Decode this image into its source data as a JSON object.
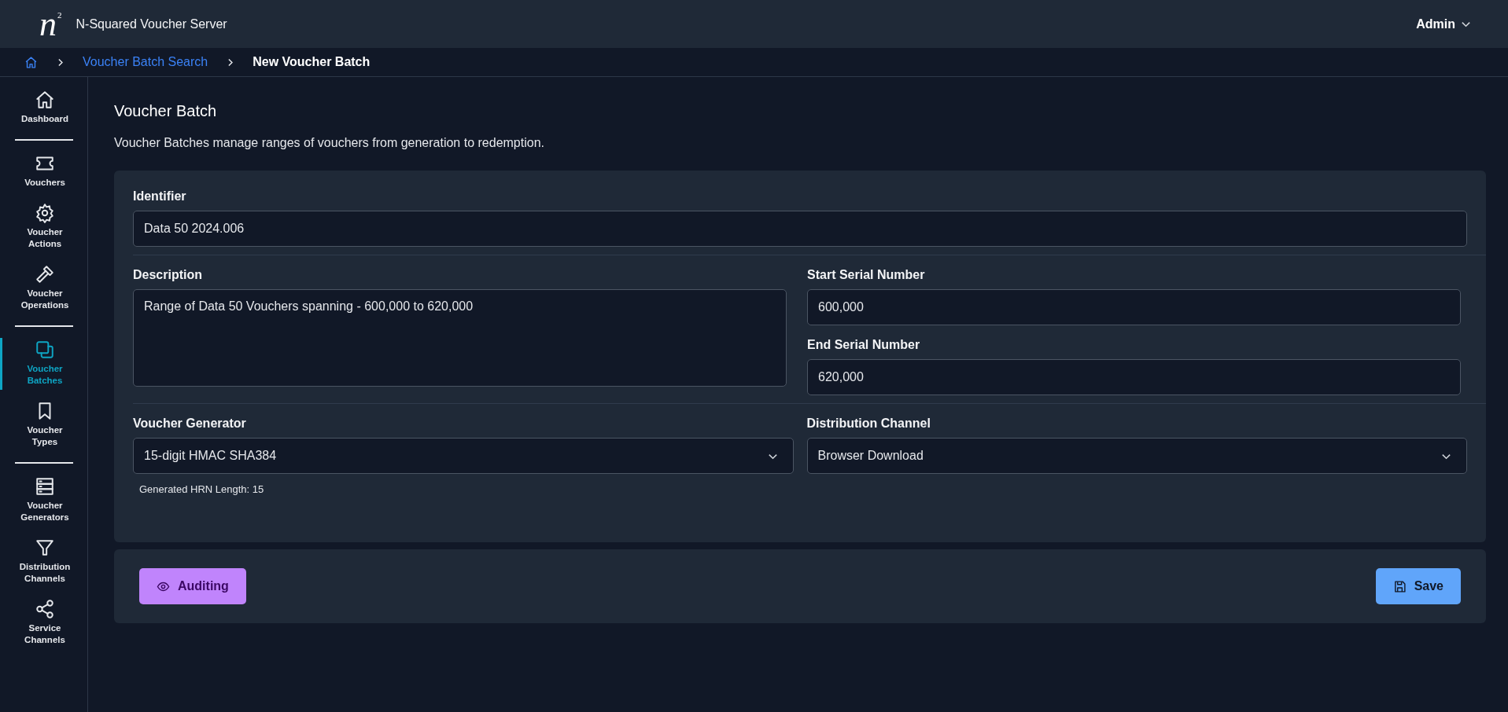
{
  "header": {
    "logo_base": "n",
    "logo_sup": "2",
    "title": "N-Squared Voucher Server",
    "user_menu": "Admin"
  },
  "breadcrumb": {
    "links": [
      "Voucher Batch Search"
    ],
    "current": "New Voucher Batch"
  },
  "sidebar": {
    "groups": [
      {
        "items": [
          {
            "kind": "home",
            "label": "Dashboard",
            "selected": false
          }
        ]
      },
      {
        "items": [
          {
            "kind": "ticket",
            "label": "Vouchers",
            "selected": false
          },
          {
            "kind": "gear",
            "label": "Voucher Actions",
            "selected": false
          },
          {
            "kind": "hammer",
            "label": "Voucher Operations",
            "selected": false
          }
        ]
      },
      {
        "items": [
          {
            "kind": "squares",
            "label": "Voucher Batches",
            "selected": true
          },
          {
            "kind": "bookmark",
            "label": "Voucher Types",
            "selected": false
          }
        ]
      },
      {
        "items": [
          {
            "kind": "server",
            "label": "Voucher Generators",
            "selected": false
          },
          {
            "kind": "funnel",
            "label": "Distribution Channels",
            "selected": false
          },
          {
            "kind": "share",
            "label": "Service Channels",
            "selected": false
          }
        ]
      }
    ]
  },
  "page": {
    "title": "Voucher Batch",
    "description": "Voucher Batches manage ranges of vouchers from generation to redemption."
  },
  "form": {
    "identifier": {
      "label": "Identifier",
      "value": "Data 50 2024.006"
    },
    "description": {
      "label": "Description",
      "value": "Range of Data 50 Vouchers spanning - 600,000 to 620,000"
    },
    "start_serial": {
      "label": "Start Serial Number",
      "value": "600,000"
    },
    "end_serial": {
      "label": "End Serial Number",
      "value": "620,000"
    },
    "voucher_generator": {
      "label": "Voucher Generator",
      "value": "15-digit HMAC SHA384",
      "help": "Generated HRN Length: 15"
    },
    "distribution_channel": {
      "label": "Distribution Channel",
      "value": "Browser Download"
    }
  },
  "actions": {
    "auditing": "Auditing",
    "save": "Save"
  }
}
